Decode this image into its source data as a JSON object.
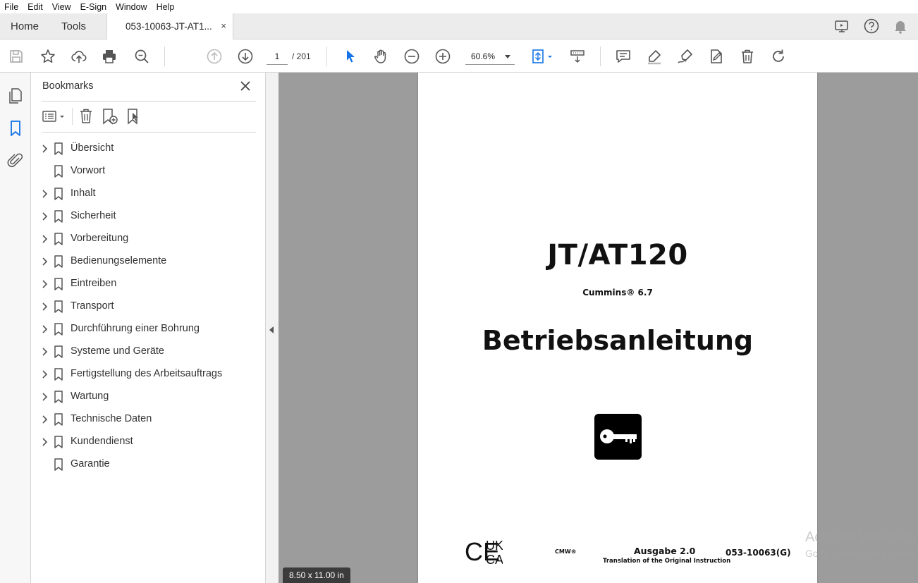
{
  "menu": [
    "File",
    "Edit",
    "View",
    "E-Sign",
    "Window",
    "Help"
  ],
  "tabs": {
    "home": "Home",
    "tools": "Tools",
    "document": "053-10063-JT-AT1...",
    "close": "×"
  },
  "toolbar": {
    "current_page": "1",
    "total_pages": "/  201",
    "zoom": "60.6%"
  },
  "bookmarks": {
    "title": "Bookmarks",
    "items": [
      {
        "label": "Übersicht",
        "expandable": true
      },
      {
        "label": "Vorwort",
        "expandable": false
      },
      {
        "label": "Inhalt",
        "expandable": true
      },
      {
        "label": "Sicherheit",
        "expandable": true
      },
      {
        "label": "Vorbereitung",
        "expandable": true
      },
      {
        "label": "Bedienungselemente",
        "expandable": true
      },
      {
        "label": "Eintreiben",
        "expandable": true
      },
      {
        "label": "Transport",
        "expandable": true
      },
      {
        "label": "Durchführung einer Bohrung",
        "expandable": true
      },
      {
        "label": "Systeme und Geräte",
        "expandable": true
      },
      {
        "label": "Fertigstellung des Arbeitsauftrags",
        "expandable": true
      },
      {
        "label": "Wartung",
        "expandable": true
      },
      {
        "label": "Technische Daten",
        "expandable": true
      },
      {
        "label": "Kundendienst",
        "expandable": true
      },
      {
        "label": "Garantie",
        "expandable": false
      }
    ]
  },
  "document": {
    "title": "JT/AT120",
    "subtitle": "Cummins® 6.7",
    "heading": "Betriebsanleitung",
    "cmw": "CMW®",
    "edition": "Ausgabe 2.0",
    "translation": "Translation of the Original Instruction",
    "doc_number": "053-10063(G)",
    "ce_marks": [
      "CE",
      "UK",
      "CA"
    ]
  },
  "page_size": "8.50 x 11.00 in",
  "watermark": {
    "line1": "Activate Windows",
    "line2": "Go to Settings to activate Windows."
  },
  "colors": {
    "accent": "#1473e6",
    "canvas": "#9c9c9c",
    "icon": "#555555"
  }
}
